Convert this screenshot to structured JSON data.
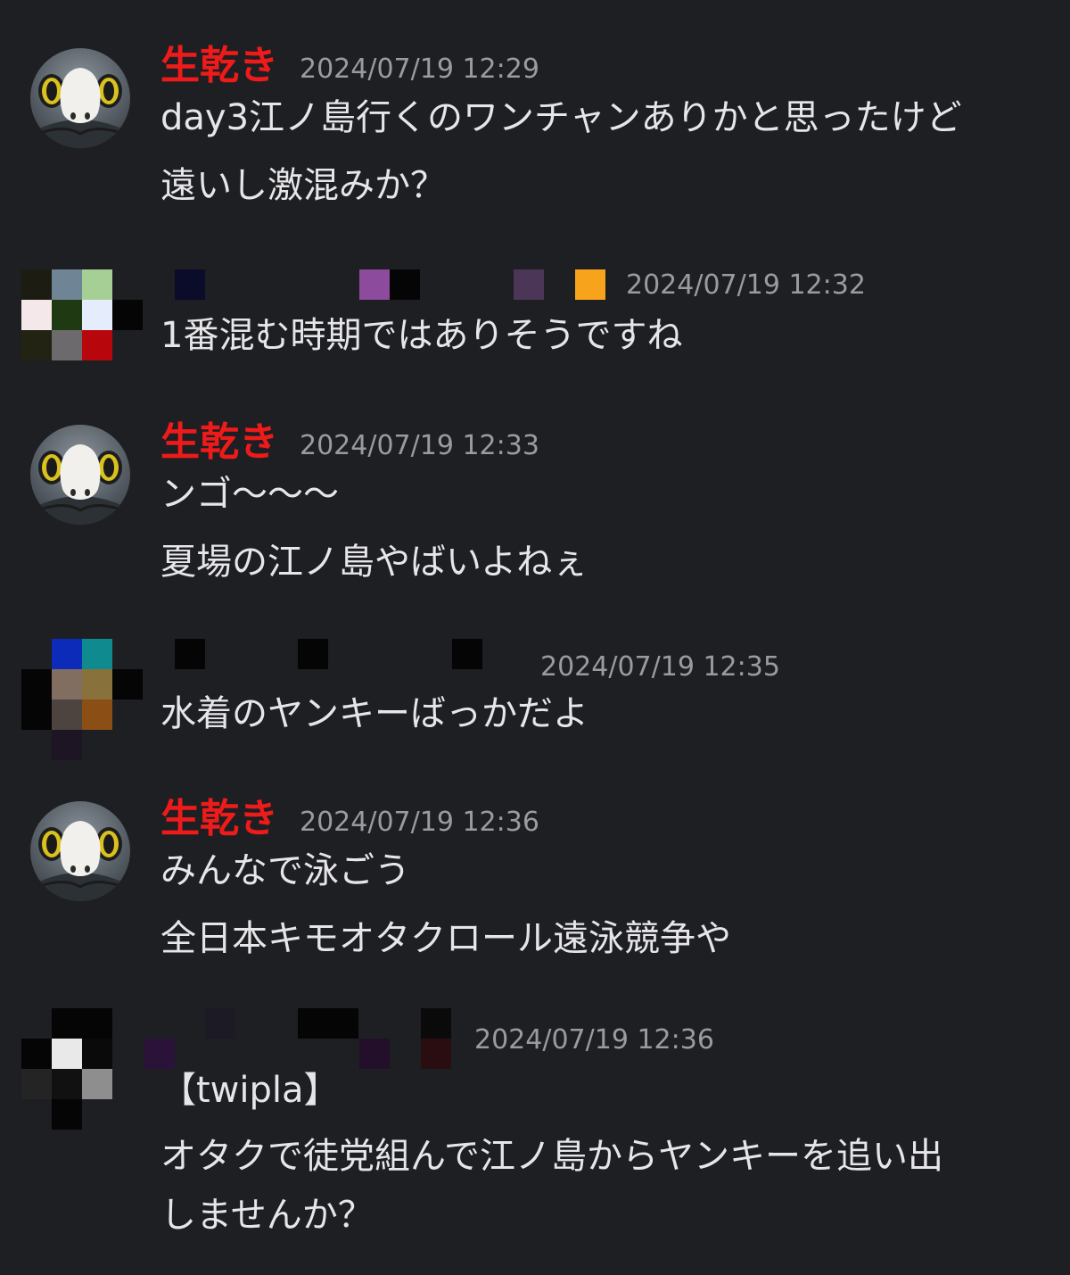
{
  "messages": [
    {
      "author": "生乾き",
      "timestamp": "2024/07/19 12:29",
      "lines": [
        "day3江ノ島行くのワンチャンありかと思ったけど",
        "遠いし激混みか？"
      ]
    },
    {
      "author": "",
      "timestamp": "2024/07/19 12:32",
      "lines": [
        "1番混む時期ではありそうですね"
      ]
    },
    {
      "author": "生乾き",
      "timestamp": "2024/07/19 12:33",
      "lines": [
        "ンゴ〜〜〜",
        "夏場の江ノ島やばいよねぇ"
      ]
    },
    {
      "author": "",
      "timestamp": "2024/07/19 12:35",
      "lines": [
        "水着のヤンキーばっかだよ"
      ]
    },
    {
      "author": "生乾き",
      "timestamp": "2024/07/19 12:36",
      "lines": [
        "みんなで泳ごう",
        "全日本キモオタクロール遠泳競争や"
      ]
    },
    {
      "author": "",
      "timestamp": "2024/07/19 12:36",
      "lines": [
        "【twipla】",
        "オタクで徒党組んで江ノ島からヤンキーを追い出",
        "しませんか？"
      ]
    }
  ],
  "colors": {
    "background": "#1e1f22",
    "author_name": "#ef1b1b",
    "timestamp": "#9a9ba1",
    "text": "#e6e6e9"
  },
  "icons": {
    "avatar_1": "penguin-mascot-icon",
    "avatar_2": "pixelated-avatar-icon",
    "avatar_3": "pixelated-avatar-icon",
    "avatar_4": "pixelated-avatar-icon"
  }
}
